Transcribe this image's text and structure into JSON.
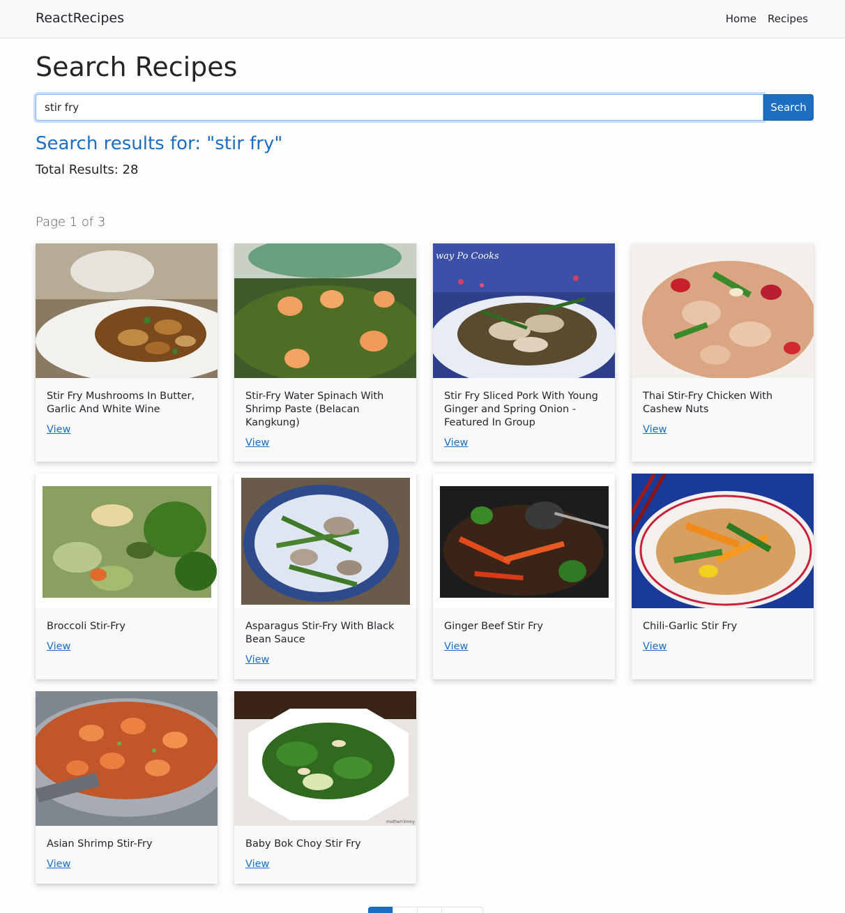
{
  "nav": {
    "brand": "ReactRecipes",
    "links": [
      "Home",
      "Recipes"
    ]
  },
  "search": {
    "title": "Search Recipes",
    "query": "stir fry",
    "button_label": "Search"
  },
  "results": {
    "heading": "Search results for: \"stir fry\"",
    "total": "Total Results: 28",
    "page_indicator": "Page 1 of 3"
  },
  "cards": [
    {
      "title": "Stir Fry Mushrooms In Butter, Garlic And White Wine",
      "link": "View"
    },
    {
      "title": "Stir-Fry Water Spinach With Shrimp Paste (Belacan Kangkung)",
      "link": "View"
    },
    {
      "title": "Stir Fry Sliced Pork With Young Ginger and Spring Onion - Featured In Group",
      "link": "View"
    },
    {
      "title": "Thai Stir-Fry Chicken With Cashew Nuts",
      "link": "View"
    },
    {
      "title": "Broccoli Stir-Fry",
      "link": "View"
    },
    {
      "title": "Asparagus Stir-Fry With Black Bean Sauce",
      "link": "View"
    },
    {
      "title": "Ginger Beef Stir Fry",
      "link": "View"
    },
    {
      "title": "Chili-Garlic Stir Fry",
      "link": "View"
    },
    {
      "title": "Asian Shrimp Stir-Fry",
      "link": "View"
    },
    {
      "title": "Baby Bok Choy Stir Fry",
      "link": "View"
    }
  ],
  "image_watermarks": [
    "way Po Cooks",
    "motherrimmy"
  ],
  "colors": {
    "accent": "#1b6ec2",
    "navbar_bg": "#f8f9fa",
    "card_bg": "#f8f9fa"
  }
}
